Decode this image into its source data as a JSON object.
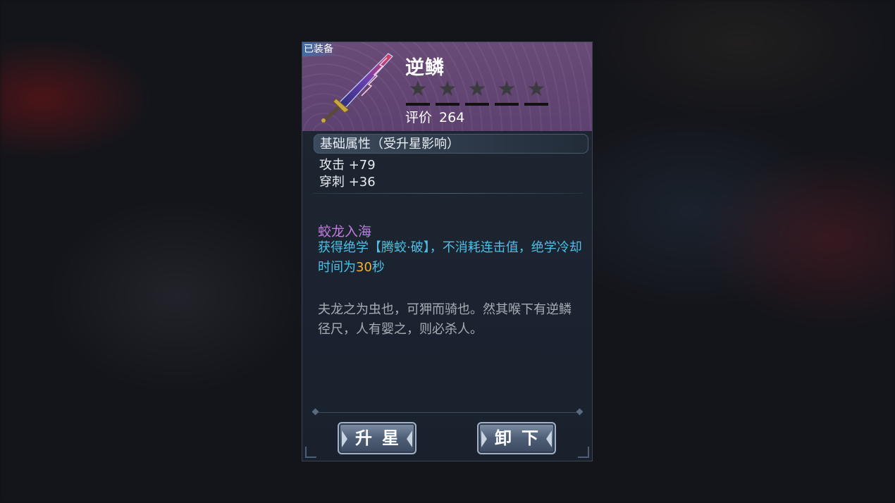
{
  "item": {
    "equipped_tag": "已装备",
    "name": "逆鳞",
    "stars": [
      "★",
      "★",
      "★",
      "★",
      "★"
    ],
    "rating_label": "评价",
    "rating_value": "264"
  },
  "base_attributes": {
    "title": "基础属性（受升星影响）",
    "attack": "攻击 +79",
    "pierce": "穿刺 +36"
  },
  "skill": {
    "name": "蛟龙入海",
    "desc_part1": "获得绝学【腾蛟·破】，不消耗连击值，绝学冷却时间为",
    "desc_highlight": "30",
    "desc_part2": "秒"
  },
  "lore": "夫龙之为虫也，可狎而骑也。然其喉下有逆鳞径尺，人有婴之，则必杀人。",
  "buttons": {
    "upgrade": "升星",
    "unequip": "卸下"
  },
  "colors": {
    "header_bg": "#5d4170",
    "skill_name": "#c27ae0",
    "skill_desc": "#4ec0e6",
    "highlight": "#f2b233"
  },
  "icons": {
    "weapon": "sword-icon",
    "star": "star-icon"
  }
}
